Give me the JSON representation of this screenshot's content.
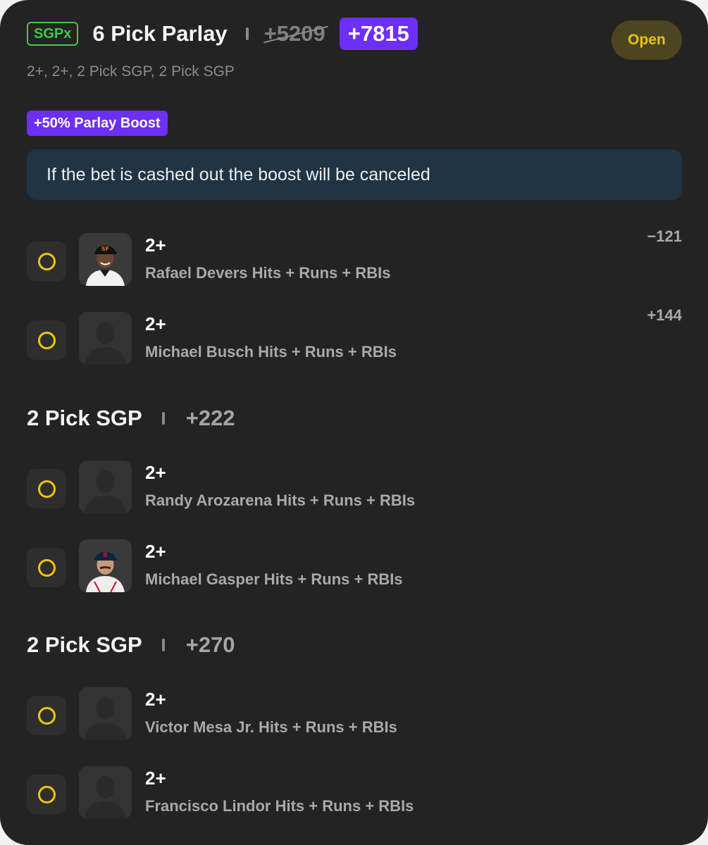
{
  "header": {
    "badge": "SGPx",
    "title": "6 Pick Parlay",
    "original_odds": "+5209",
    "boosted_odds": "+7815",
    "status": "Open",
    "legs_summary": "2+, 2+, 2 Pick SGP, 2 Pick SGP"
  },
  "boost": {
    "label": "+50% Parlay Boost",
    "notice": "If the bet is cashed out the boost will be canceled"
  },
  "legs": [
    {
      "line": "2+",
      "market": "Rafael Devers Hits + Runs + RBIs",
      "odds": "−121",
      "avatar": "giants-player-photo"
    },
    {
      "line": "2+",
      "market": "Michael Busch Hits + Runs + RBIs",
      "odds": "+144",
      "avatar": "placeholder-silhouette"
    }
  ],
  "groups": [
    {
      "title": "2 Pick SGP",
      "odds": "+222",
      "legs": [
        {
          "line": "2+",
          "market": "Randy Arozarena Hits + Runs + RBIs",
          "avatar": "placeholder-silhouette"
        },
        {
          "line": "2+",
          "market": "Michael Gasper Hits + Runs + RBIs",
          "avatar": "redsox-player-photo"
        }
      ]
    },
    {
      "title": "2 Pick SGP",
      "odds": "+270",
      "legs": [
        {
          "line": "2+",
          "market": "Victor Mesa Jr. Hits + Runs + RBIs",
          "avatar": "placeholder-silhouette"
        },
        {
          "line": "2+",
          "market": "Francisco Lindor Hits + Runs + RBIs",
          "avatar": "placeholder-silhouette"
        }
      ]
    }
  ],
  "colors": {
    "card_bg": "#232323",
    "accent_purple": "#6d2ff5",
    "sgpx_green": "#3ec94e",
    "radio_yellow": "#f1c40f",
    "notice_bg": "#1f3445",
    "status_text": "#e7c317"
  }
}
